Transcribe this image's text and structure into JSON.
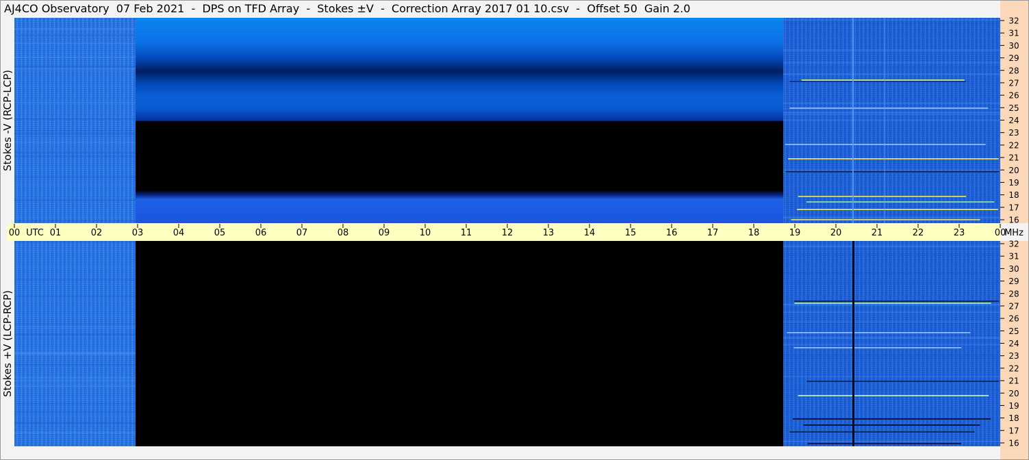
{
  "title": "AJ4CO Observatory  07 Feb 2021  -  DPS on TFD Array  -  Stokes ±V  -  Correction Array 2017 01 10.csv  -  Offset 50  Gain 2.0",
  "chart_data": [
    {
      "type": "heatmap",
      "panel": "top",
      "ylabel": "Stokes -V (RCP-LCP)",
      "x_unit": "UTC",
      "x_ticks": [
        "00",
        "01",
        "02",
        "03",
        "04",
        "05",
        "06",
        "07",
        "08",
        "09",
        "10",
        "11",
        "12",
        "13",
        "14",
        "15",
        "16",
        "17",
        "18",
        "19",
        "20",
        "21",
        "22",
        "23",
        "00"
      ],
      "y_unit": "MHz",
      "y_ticks": [
        16,
        17,
        18,
        19,
        20,
        21,
        22,
        23,
        24,
        25,
        26,
        27,
        28,
        29,
        30,
        31,
        32
      ],
      "ylim": [
        16,
        32
      ],
      "segments": [
        {
          "from_utc": 0.0,
          "to_utc": 2.95,
          "content": "noise"
        },
        {
          "from_utc": 2.95,
          "to_utc": 18.72,
          "content": "smooth gradient (no data above noise)"
        },
        {
          "from_utc": 18.72,
          "to_utc": 24.0,
          "content": "noise with interference lines"
        }
      ]
    },
    {
      "type": "heatmap",
      "panel": "bottom",
      "ylabel": "Stokes +V (LCP-RCP)",
      "x_unit": "UTC",
      "x_ticks": [
        "00",
        "01",
        "02",
        "03",
        "04",
        "05",
        "06",
        "07",
        "08",
        "09",
        "10",
        "11",
        "12",
        "13",
        "14",
        "15",
        "16",
        "17",
        "18",
        "19",
        "20",
        "21",
        "22",
        "23",
        "00"
      ],
      "y_unit": "MHz",
      "y_ticks": [
        16,
        17,
        18,
        19,
        20,
        21,
        22,
        23,
        24,
        25,
        26,
        27,
        28,
        29,
        30,
        31,
        32
      ],
      "ylim": [
        16,
        32
      ],
      "segments": [
        {
          "from_utc": 0.0,
          "to_utc": 2.95,
          "content": "noise"
        },
        {
          "from_utc": 2.95,
          "to_utc": 18.72,
          "content": "black (blank)"
        },
        {
          "from_utc": 18.72,
          "to_utc": 24.0,
          "content": "noise with interference lines"
        }
      ]
    }
  ],
  "colors": {
    "time_bar": "#ffffc0",
    "freq_bar": "#fbd8b8",
    "noise_blue": "#1f6fe6",
    "blank": "#000000"
  }
}
